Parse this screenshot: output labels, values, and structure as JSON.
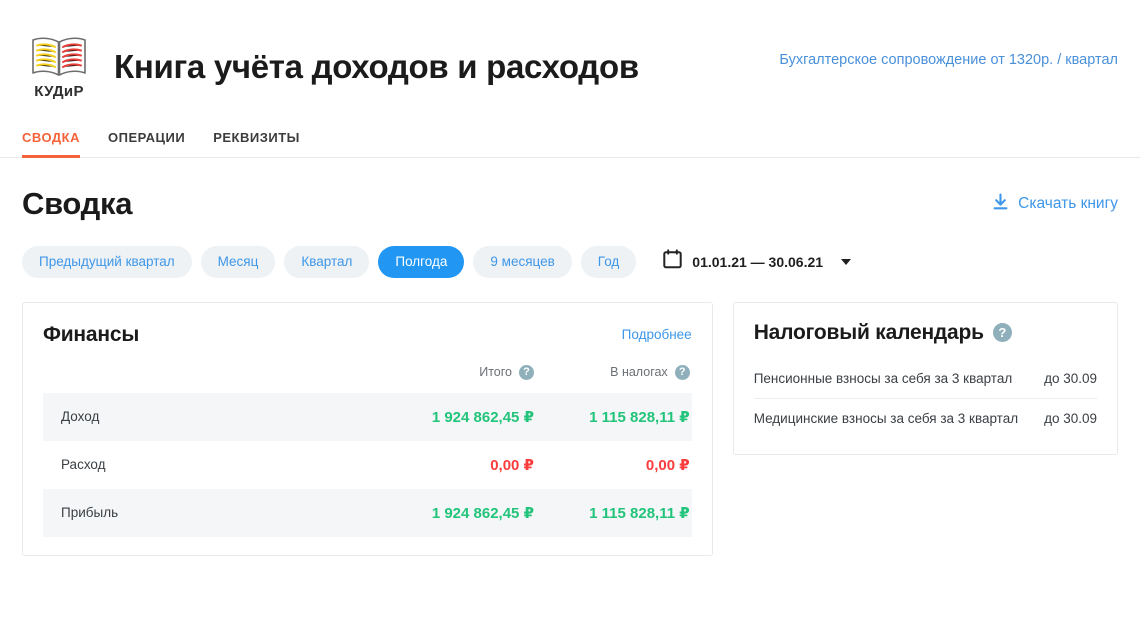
{
  "header": {
    "logo_caption": "КУДиР",
    "logo_icon": "open-book-icon",
    "title": "Книга учёта доходов и расходов",
    "promo_link": "Бухгалтерское сопровождение от 1320р. / квартал"
  },
  "tabs": [
    {
      "label": "СВОДКА",
      "active": true
    },
    {
      "label": "ОПЕРАЦИИ",
      "active": false
    },
    {
      "label": "РЕКВИЗИТЫ",
      "active": false
    }
  ],
  "page": {
    "title": "Сводка",
    "download_label": "Скачать книгу",
    "download_icon": "download-icon"
  },
  "filters": {
    "chips": [
      {
        "label": "Предыдущий квартал",
        "active": false
      },
      {
        "label": "Месяц",
        "active": false
      },
      {
        "label": "Квартал",
        "active": false
      },
      {
        "label": "Полгода",
        "active": true
      },
      {
        "label": "9 месяцев",
        "active": false
      },
      {
        "label": "Год",
        "active": false
      }
    ],
    "date_range": "01.01.21 — 30.06.21",
    "calendar_icon": "calendar-icon",
    "chevron_icon": "chevron-down-icon"
  },
  "finance_card": {
    "title": "Финансы",
    "details_link": "Подробнее",
    "columns": [
      {
        "label": "",
        "help": false
      },
      {
        "label": "Итого",
        "help": true
      },
      {
        "label": "В налогах",
        "help": true
      }
    ],
    "rows": [
      {
        "name": "Доход",
        "total": "1 924 862,45 ₽",
        "taxes": "1 115 828,11 ₽",
        "sign": "pos",
        "shaded": true
      },
      {
        "name": "Расход",
        "total": "0,00 ₽",
        "taxes": "0,00 ₽",
        "sign": "neg",
        "shaded": false
      },
      {
        "name": "Прибыль",
        "total": "1 924 862,45 ₽",
        "taxes": "1 115 828,11 ₽",
        "sign": "pos",
        "shaded": true
      }
    ]
  },
  "calendar_card": {
    "title": "Налоговый календарь",
    "help": "?",
    "items": [
      {
        "label": "Пенсионные взносы за себя за 3 квартал",
        "due": "до 30.09"
      },
      {
        "label": "Медицинские взносы за себя за 3 квартал",
        "due": "до 30.09"
      }
    ]
  },
  "colors": {
    "accent_orange": "#f4623a",
    "link_blue": "#3e97e8",
    "chip_blue": "#2196f3",
    "positive_green": "#21c47a",
    "negative_red": "#fa3c3c",
    "help_gray": "#8fb0bb"
  }
}
